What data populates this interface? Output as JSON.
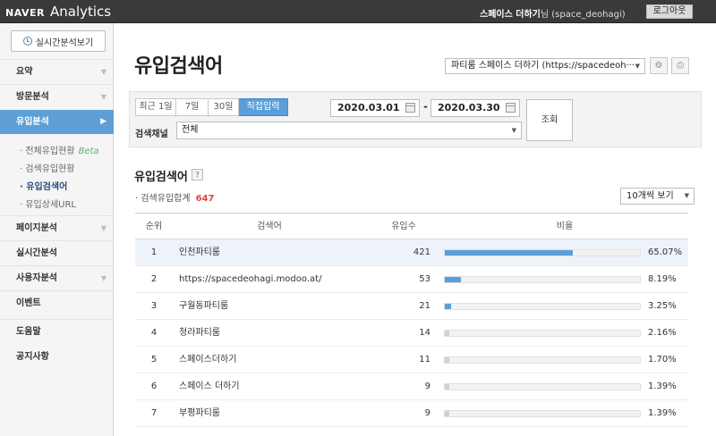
{
  "header": {
    "logo_naver": "NAVER",
    "logo_analytics": "Analytics",
    "user_name": "스페이스 더하기",
    "user_suffix": "님 (space_deohagi)",
    "logout_label": "로그아웃"
  },
  "sidebar": {
    "realtime_button": "실시간분석보기",
    "menus": [
      {
        "label": "요약"
      },
      {
        "label": "방문분석"
      },
      {
        "label": "유입분석"
      },
      {
        "label": "페이지분석"
      },
      {
        "label": "실시간분석"
      },
      {
        "label": "사용자분석"
      },
      {
        "label": "이벤트"
      },
      {
        "label": "도움말"
      },
      {
        "label": "공지사항"
      }
    ],
    "submenus": [
      {
        "label": "· 전체유입현황",
        "badge": "Beta"
      },
      {
        "label": "· 검색유입현황"
      },
      {
        "label": "· 유입검색어"
      },
      {
        "label": "· 유입상세URL"
      }
    ]
  },
  "main": {
    "page_title": "유입검색어",
    "site_select": "파티룸 스페이스 더하기 (https://spacedeoh···",
    "period_tabs": [
      "최근 1일",
      "7일",
      "30일",
      "직접입력"
    ],
    "active_tab": "직접입력",
    "date_from": "2020.03.01",
    "date_to": "2020.03.30",
    "date_separator": "-",
    "search_button": "조회",
    "channel_label": "검색채널",
    "channel_value": "전체",
    "section_title": "유입검색어",
    "help_label": "?",
    "total_label": "· 검색유입합계",
    "total_value": "647",
    "per_page": "10개씩 보기",
    "table": {
      "headers": [
        "순위",
        "검색어",
        "유입수",
        "비율"
      ],
      "rows": [
        {
          "rank": "1",
          "keyword": "인천파티룸",
          "count": "421",
          "percent": "65.07%",
          "ratio": 0.6507
        },
        {
          "rank": "2",
          "keyword": "https://spacedeohagi.modoo.at/",
          "count": "53",
          "percent": "8.19%",
          "ratio": 0.0819
        },
        {
          "rank": "3",
          "keyword": "구월동파티룸",
          "count": "21",
          "percent": "3.25%",
          "ratio": 0.0325
        },
        {
          "rank": "4",
          "keyword": "청라파티룸",
          "count": "14",
          "percent": "2.16%",
          "ratio": 0.0216
        },
        {
          "rank": "5",
          "keyword": "스페이스더하기",
          "count": "11",
          "percent": "1.70%",
          "ratio": 0.017
        },
        {
          "rank": "6",
          "keyword": "스페이스 더하기",
          "count": "9",
          "percent": "1.39%",
          "ratio": 0.0139
        },
        {
          "rank": "7",
          "keyword": "부평파티룸",
          "count": "9",
          "percent": "1.39%",
          "ratio": 0.0139
        }
      ]
    }
  },
  "colors": {
    "accent": "#5b9fd9",
    "bar_primary": "#5b9fd9",
    "bar_minor": "#c8d3e0",
    "total_highlight": "#e0473c"
  },
  "icons": {
    "realtime": "clock-icon",
    "settings": "gear-icon",
    "print": "printer-icon",
    "calendar": "calendar-icon",
    "help": "question-icon",
    "dropdown": "caret-down-icon"
  }
}
